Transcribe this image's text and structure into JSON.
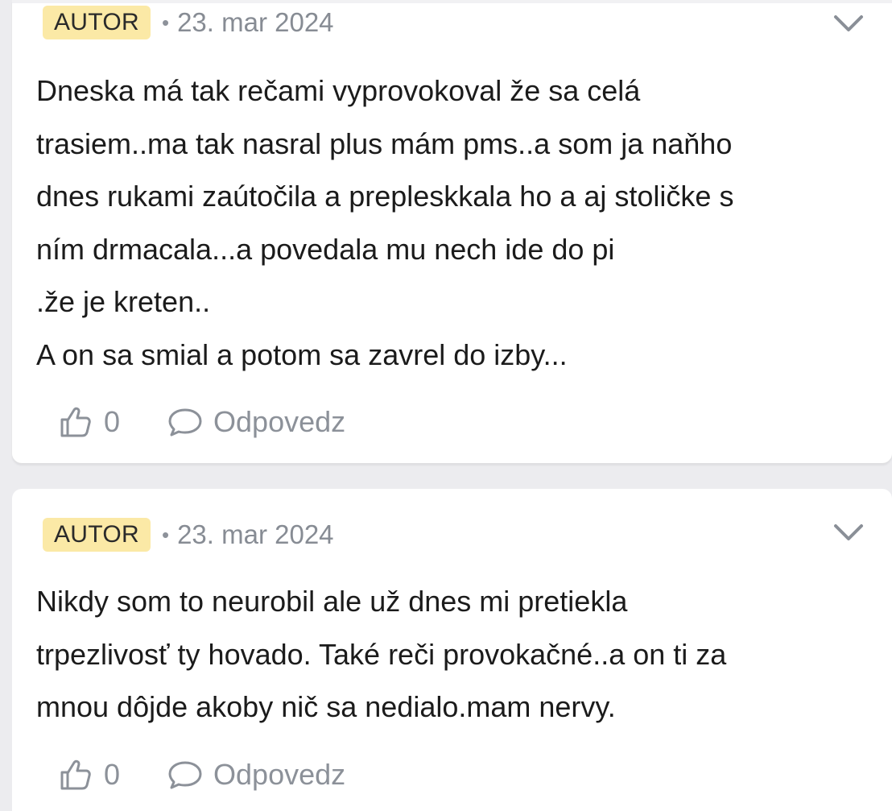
{
  "comments": [
    {
      "badge": "AUTOR",
      "separator": "•",
      "date": "23. mar 2024",
      "lines": [
        "Dneska má tak rečami vyprovokoval že sa celá",
        "trasiem..ma tak nasral plus mám pms..a som ja naňho",
        "dnes rukami zaútočila a prepleskkala ho a aj stoličke s",
        "ním drmacala...a povedala mu nech ide do pi",
        ".že je kreten..",
        "A on sa smial a potom sa zavrel do izby..."
      ],
      "likes": "0",
      "reply_label": "Odpovedz"
    },
    {
      "badge": "AUTOR",
      "separator": "•",
      "date": "23. mar 2024",
      "lines": [
        "Nikdy som to neurobil ale už dnes mi pretiekla",
        "trpezlivosť ty hovado. Také reči provokačné..a on ti za",
        "mnou dôjde akoby nič sa nedialo.mam nervy."
      ],
      "likes": "0",
      "reply_label": "Odpovedz"
    }
  ],
  "icons": {
    "expand": "chevron-down-icon",
    "like": "thumbs-up-icon",
    "reply": "speech-bubble-icon"
  },
  "colors": {
    "badge_bg": "#fbe9a6",
    "muted_text": "#878c94",
    "page_bg": "#ececef"
  }
}
